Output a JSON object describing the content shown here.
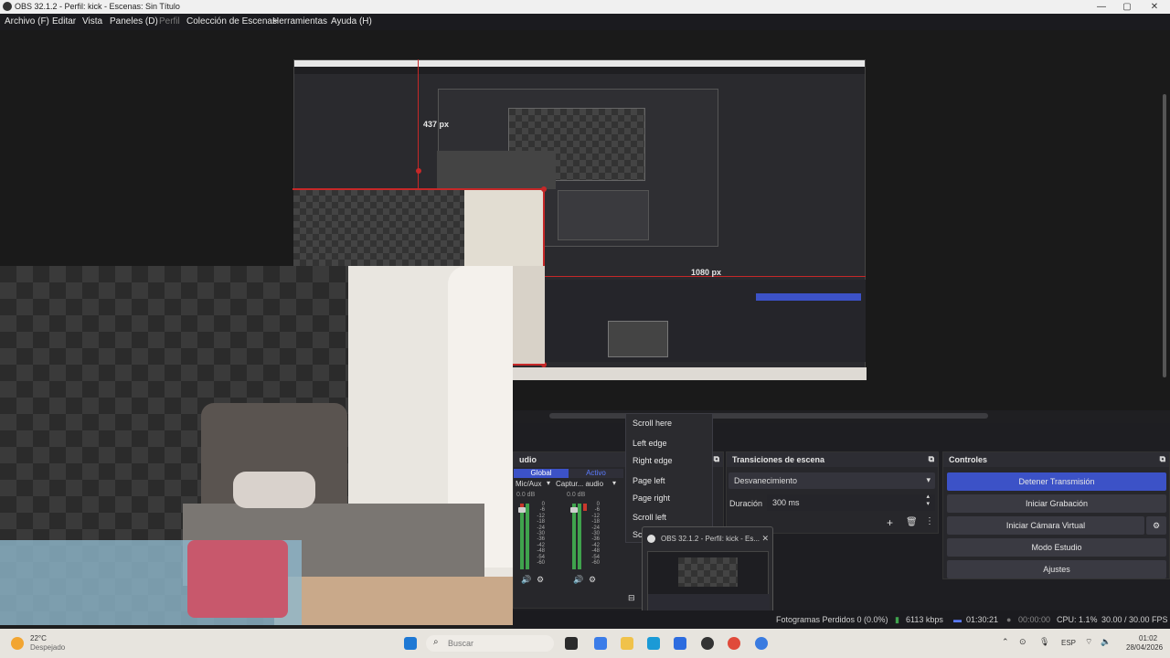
{
  "window": {
    "title": "OBS 32.1.2 - Perfil: kick - Escenas: Sin Título"
  },
  "menu": {
    "items": [
      "Archivo (F)",
      "Editar",
      "Vista",
      "Paneles (D)",
      "Perfil",
      "Colección de Escenas",
      "Herramientas",
      "Ayuda (H)"
    ]
  },
  "preview": {
    "measure_vertical": "437 px",
    "measure_horizontal": "1080 px"
  },
  "audio": {
    "title": "udio",
    "tabs": [
      "Global",
      "Activo"
    ],
    "channels": [
      {
        "name": "Mic/Aux",
        "db": "0.0 dB"
      },
      {
        "name": "Captur... audio",
        "db": "0.0 dB"
      }
    ],
    "scale": [
      "0",
      "-6",
      "-12",
      "-18",
      "-24",
      "-30",
      "-36",
      "-42",
      "-48",
      "-54",
      "-60"
    ]
  },
  "transitions": {
    "title": "Transiciones de escena",
    "selected": "Desvanecimiento",
    "duration_label": "Duración",
    "duration_value": "300 ms"
  },
  "controls": {
    "title": "Controles",
    "stop_stream": "Detener Transmisión",
    "start_recording": "Iniciar Grabación",
    "start_virtual_cam": "Iniciar Cámara Virtual",
    "studio_mode": "Modo Estudio",
    "settings": "Ajustes"
  },
  "context_menu": {
    "items": [
      "Scroll here",
      "Left edge",
      "Right edge",
      "Page left",
      "Page right",
      "Scroll left",
      "Sc"
    ]
  },
  "taskbar_thumbnail": {
    "title": "OBS 32.1.2 - Perfil: kick - Es..."
  },
  "status_bar": {
    "dropped_frames": "Fotogramas Perdidos 0 (0.0%)",
    "bitrate": "6113 kbps",
    "stream_time": "01:30:21",
    "record_time": "00:00:00",
    "cpu": "CPU: 1.1%",
    "fps": "30.00 / 30.00 FPS"
  },
  "taskbar": {
    "weather_temp": "22°C",
    "weather_desc": "Despejado",
    "search_placeholder": "Buscar",
    "language": "ESP",
    "time": "01:02",
    "date": "28/04/2026"
  },
  "colors": {
    "accent": "#3c52c7",
    "meter_green": "#3fa34d",
    "selection_red": "#c62828"
  }
}
